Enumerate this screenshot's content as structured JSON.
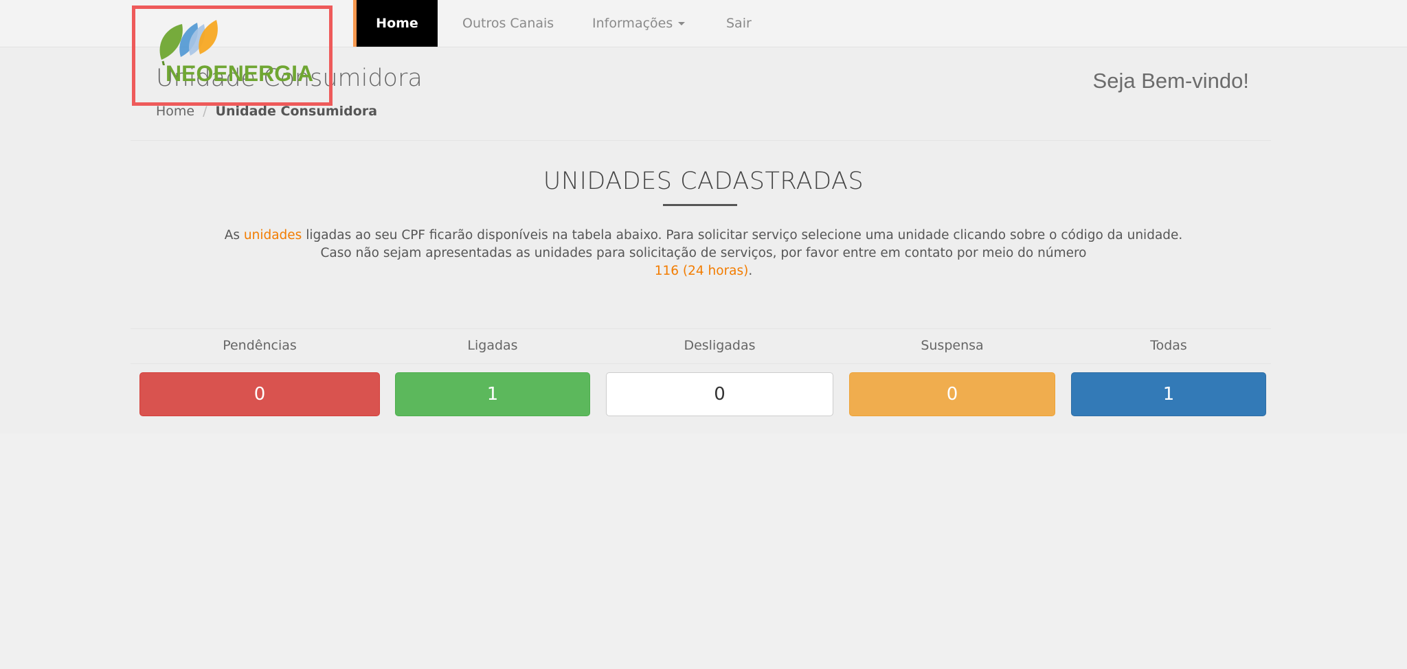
{
  "nav": {
    "items": [
      {
        "label": "Home",
        "active": true
      },
      {
        "label": "Outros Canais"
      },
      {
        "label": "Informações",
        "has_dropdown": true
      },
      {
        "label": "Sair"
      }
    ]
  },
  "logo": {
    "text": "NEOENERGIA"
  },
  "header": {
    "title": "Unidade Consumidora",
    "welcome": "Seja Bem-vindo!"
  },
  "breadcrumb": {
    "home": "Home",
    "separator": "/",
    "current": "Unidade Consumidora"
  },
  "section": {
    "title": "UNIDADES CADASTRADAS",
    "line1_prefix": "As ",
    "line1_highlight": "unidades",
    "line1_rest": " ligadas ao seu CPF ficarão disponíveis na tabela abaixo. Para solicitar serviço selecione uma unidade clicando sobre o código da unidade.",
    "line2": "Caso não sejam apresentadas as unidades para solicitação de serviços, por favor entre em contato por meio do número",
    "phone": "116 (24 horas)",
    "line3_suffix": "."
  },
  "status": [
    {
      "label": "Pendências",
      "count": "0",
      "color": "#d9534f"
    },
    {
      "label": "Ligadas",
      "count": "1",
      "color": "#5cb85c"
    },
    {
      "label": "Desligadas",
      "count": "0",
      "color": "#ffffff"
    },
    {
      "label": "Suspensa",
      "count": "0",
      "color": "#f0ad4e"
    },
    {
      "label": "Todas",
      "count": "1",
      "color": "#337ab7"
    }
  ],
  "colors": {
    "accent": "#f27c00",
    "nav_active_bg": "#000000",
    "logo_green": "#6fa632",
    "highlight_border": "#ee5a5a"
  }
}
